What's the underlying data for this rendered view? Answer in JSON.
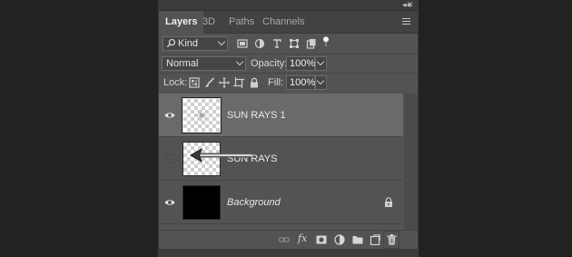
{
  "window": {
    "collapse_glyph": "◂◂",
    "close_glyph": "✕"
  },
  "tabs": [
    {
      "label": "Layers",
      "active": true
    },
    {
      "label": "3D",
      "active": false
    },
    {
      "label": "Paths",
      "active": false
    },
    {
      "label": "Channels",
      "active": false
    }
  ],
  "filter": {
    "search_icon": "search-icon",
    "kind_label": "Kind",
    "filter_icons": [
      "image-filter-icon",
      "adjustment-filter-icon",
      "type-filter-icon",
      "shape-filter-icon",
      "smart-object-filter-icon",
      "filter-toggle-icon"
    ]
  },
  "blend": {
    "mode": "Normal",
    "opacity_label": "Opacity:",
    "opacity_value": "100%"
  },
  "lock": {
    "label": "Lock:",
    "icons": [
      "lock-transparent-icon",
      "lock-image-icon",
      "lock-position-icon",
      "lock-artboard-icon",
      "lock-all-icon"
    ],
    "fill_label": "Fill:",
    "fill_value": "100%"
  },
  "layers": [
    {
      "name": "SUN RAYS 1",
      "visible": true,
      "selected": true,
      "thumbnail": "checker-with-rays",
      "italic": false,
      "locked": false
    },
    {
      "name": "SUN RAYS",
      "visible": false,
      "selected": false,
      "thumbnail": "checker",
      "italic": false,
      "locked": false
    },
    {
      "name": "Background",
      "visible": true,
      "selected": false,
      "thumbnail": "black",
      "italic": true,
      "locked": true
    }
  ],
  "footer_icons": [
    "link-layers-icon",
    "fx-icon",
    "add-mask-icon",
    "adjustment-layer-icon",
    "group-folder-icon",
    "new-layer-icon",
    "trash-icon"
  ],
  "footer": {
    "fx_label": "fx"
  },
  "colors": {
    "panel_bg": "#535353",
    "selected_row": "#6a6a6a",
    "page_bg": "#222222"
  }
}
